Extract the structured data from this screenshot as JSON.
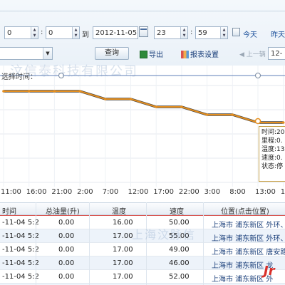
{
  "toolbar": {
    "start_hour": "0",
    "start_minute": "0",
    "to_label": "到",
    "end_date": "2012-11-05",
    "end_hour": "23",
    "end_minute": "59",
    "today_label": "今天",
    "yesterday_label": "昨天",
    "query_label": "查询",
    "export_label": "导出",
    "report_settings_label": "报表设置",
    "prev_label": "上一辆",
    "next_select_value": "12-",
    "select_time_label": "选择时间："
  },
  "chart": {
    "tooltip_lines": [
      "时间:20",
      "里程:0.",
      "温度:13",
      "速度:0.",
      "状态:停"
    ],
    "watermark_top": "汶信泰科技有限公司",
    "watermark_bottom": "上海汶脉信"
  },
  "chart_data": {
    "type": "line",
    "x": [
      "11:00",
      "16:00",
      "21:00",
      "2:00",
      "7:00",
      "12:00",
      "17:00",
      "22:00",
      "3:00",
      "8:00",
      "13:00",
      "18"
    ],
    "series": [
      {
        "values": [
          17,
          17,
          17,
          17,
          16,
          16,
          15,
          15,
          14,
          14,
          13,
          13
        ]
      }
    ],
    "grid": true,
    "colors": {
      "line": "#e58f1f",
      "shadow": "#444444",
      "hover_line": "#5f7fb8"
    }
  },
  "table": {
    "columns": [
      "时间",
      "总油量(升)",
      "温度",
      "速度",
      "位置(点击位置)"
    ],
    "rows": [
      {
        "time": "-11-04 5:2",
        "fuel": "0.00",
        "temp": "16.00",
        "speed": "50.00",
        "location": "上海市 浦东新区 外环、"
      },
      {
        "time": "-11-04 5:2",
        "fuel": "0.00",
        "temp": "17.00",
        "speed": "55.00",
        "location": "上海市 浦东新区 外环、"
      },
      {
        "time": "-11-04 5:2",
        "fuel": "0.00",
        "temp": "17.00",
        "speed": "49.00",
        "location": "上海市 浦东新区 唐安路"
      },
      {
        "time": "-11-04 5:2",
        "fuel": "0.00",
        "temp": "17.00",
        "speed": "46.00",
        "location": "上海市 浦东新区 龙"
      },
      {
        "time": "-11-04 5:2",
        "fuel": "0.00",
        "temp": "17.00",
        "speed": "52.00",
        "location": "上海市 浦东新区 外"
      },
      {
        "time": "-11-04 5:2",
        "fuel": "0.00",
        "temp": "17.00",
        "speed": "5",
        "location": "上海市 浦东新区"
      }
    ]
  },
  "brand_mark": "Jr"
}
